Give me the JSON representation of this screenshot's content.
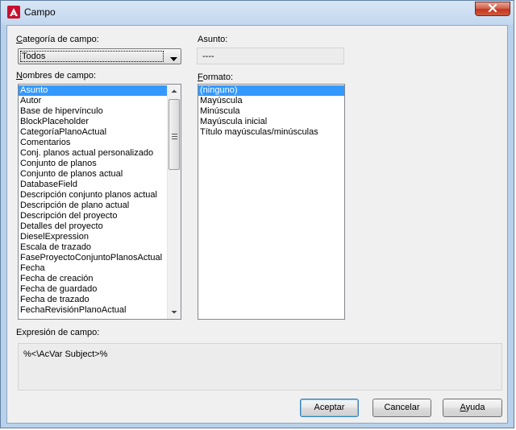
{
  "window": {
    "title": "Campo"
  },
  "category": {
    "label": "Categoría de campo:",
    "selected": "Todos"
  },
  "subject": {
    "label": "Asunto:",
    "value": "----"
  },
  "field_names": {
    "label": "Nombres de campo:",
    "items": [
      "Asunto",
      "Autor",
      "Base de hipervínculo",
      "BlockPlaceholder",
      "CategoríaPlanoActual",
      "Comentarios",
      "Conj. planos actual personalizado",
      "Conjunto de planos",
      "Conjunto de planos actual",
      "DatabaseField",
      "Descripción conjunto planos actual",
      "Descripción de plano actual",
      "Descripción del proyecto",
      "Detalles del proyecto",
      "DieselExpression",
      "Escala de trazado",
      "FaseProyectoConjuntoPlanosActual",
      "Fecha",
      "Fecha de creación",
      "Fecha de guardado",
      "Fecha de trazado",
      "FechaRevisiónPlanoActual"
    ],
    "selected_index": 0
  },
  "format": {
    "label": "Formato:",
    "items": [
      "(ninguno)",
      "Mayúscula",
      "Minúscula",
      "Mayúscula inicial",
      "Título mayúsculas/minúsculas"
    ],
    "selected_index": 0
  },
  "expression": {
    "label": "Expresión de campo:",
    "value": "%<\\AcVar Subject>%"
  },
  "buttons": {
    "ok": "Aceptar",
    "cancel": "Cancelar",
    "help": "Ayuda"
  }
}
